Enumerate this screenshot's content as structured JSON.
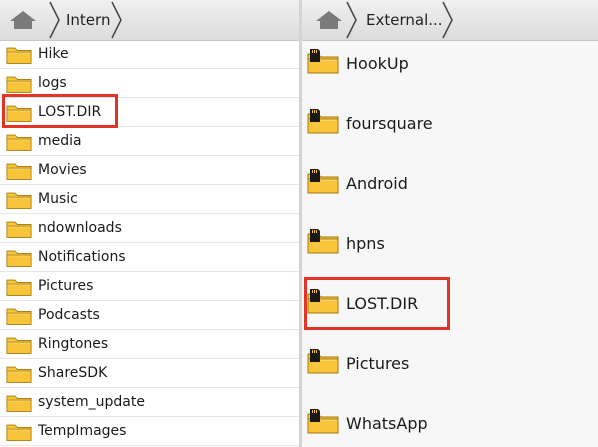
{
  "left_pane": {
    "breadcrumb": "Interna",
    "folders": [
      {
        "label": "Hike"
      },
      {
        "label": "logs"
      },
      {
        "label": "LOST.DIR",
        "highlighted": true
      },
      {
        "label": "media"
      },
      {
        "label": "Movies"
      },
      {
        "label": "Music"
      },
      {
        "label": "ndownloads"
      },
      {
        "label": "Notifications"
      },
      {
        "label": "Pictures"
      },
      {
        "label": "Podcasts"
      },
      {
        "label": "Ringtones"
      },
      {
        "label": "ShareSDK"
      },
      {
        "label": "system_update"
      },
      {
        "label": "TempImages"
      }
    ]
  },
  "right_pane": {
    "breadcrumb": "External...",
    "folders": [
      {
        "label": "HookUp"
      },
      {
        "label": "foursquare"
      },
      {
        "label": "Android"
      },
      {
        "label": "hpns"
      },
      {
        "label": "LOST.DIR",
        "highlighted": true
      },
      {
        "label": "Pictures"
      },
      {
        "label": "WhatsApp"
      }
    ]
  },
  "icons": {
    "home": "home-icon",
    "folder": "folder-icon",
    "sd_folder": "sd-card-folder-icon"
  },
  "colors": {
    "folder_fill": "#f8c43a",
    "highlight_border": "#e53325"
  }
}
